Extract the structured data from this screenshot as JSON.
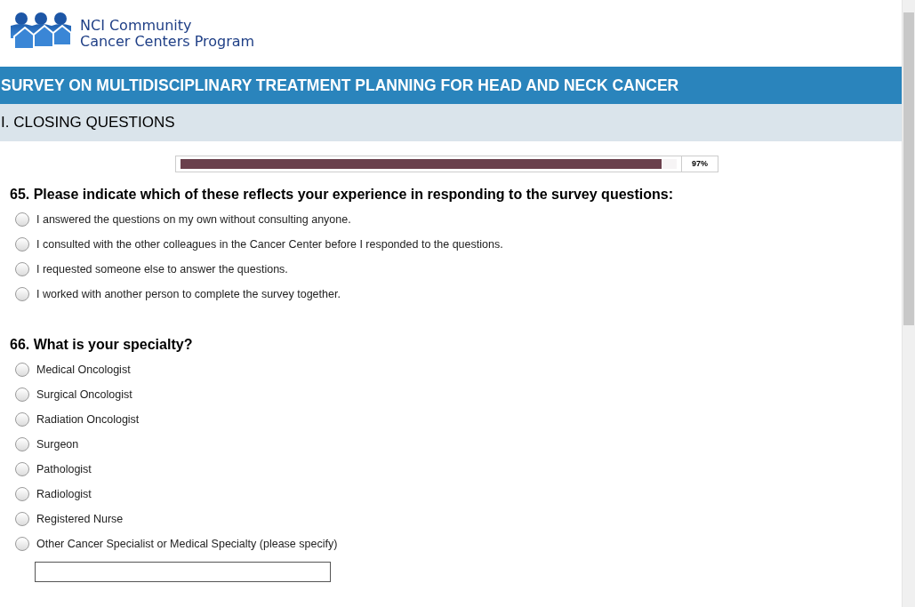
{
  "logo": {
    "line_1": "NCI Community",
    "line_2": "Cancer Centers Program"
  },
  "survey_title": "SURVEY ON MULTIDISCIPLINARY TREATMENT PLANNING FOR HEAD AND NECK CANCER",
  "section_title": "I. CLOSING QUESTIONS",
  "progress": {
    "level": 0.97,
    "reading": "97%"
  },
  "questions": [
    {
      "title": "65. Please indicate which of these reflects your experience in responding to the survey questions:",
      "options": [
        {
          "label": "I answered the questions on my own without consulting anyone.",
          "selected": false
        },
        {
          "label": "I consulted with the other colleagues in the Cancer Center before I responded to the questions.",
          "selected": false
        },
        {
          "label": "I requested someone else to answer the questions.",
          "selected": false
        },
        {
          "label": "I worked with another person to complete the survey together.",
          "selected": false
        }
      ]
    },
    {
      "title": "66. What is your specialty?",
      "options": [
        {
          "label": "Medical Oncologist",
          "selected": false
        },
        {
          "label": "Surgical Oncologist",
          "selected": false
        },
        {
          "label": "Radiation Oncologist",
          "selected": false
        },
        {
          "label": "Surgeon",
          "selected": false
        },
        {
          "label": "Pathologist",
          "selected": false
        },
        {
          "label": "Radiologist",
          "selected": false
        },
        {
          "label": "Registered Nurse",
          "selected": false
        },
        {
          "label": "Other Cancer Specialist or Medical Specialty (please specify)",
          "selected": false
        }
      ],
      "other_field": true
    }
  ]
}
